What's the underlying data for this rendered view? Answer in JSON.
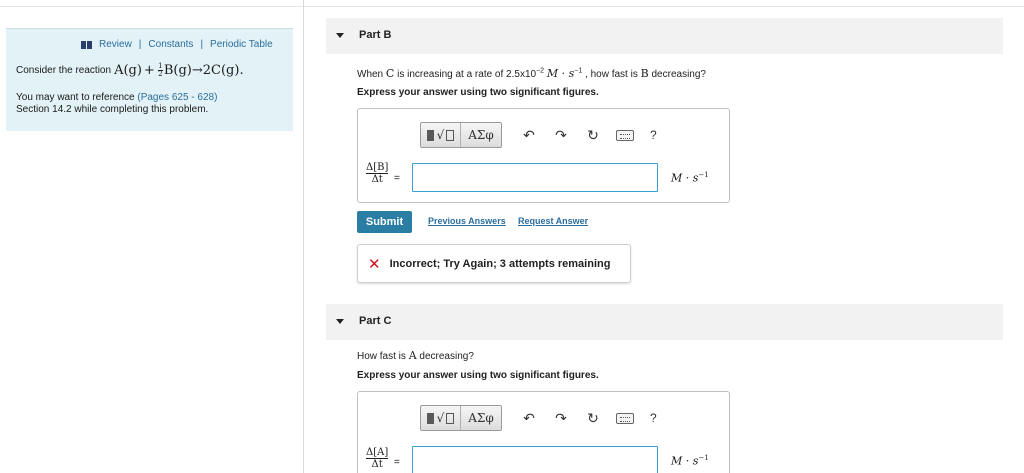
{
  "left_panel": {
    "links": {
      "review": "Review",
      "constants": "Constants",
      "periodic_table": "Periodic Table"
    },
    "reaction_prefix": "Consider the reaction",
    "reaction": {
      "a": "A(g)",
      "plus": "+",
      "half_num": "1",
      "half_den": "2",
      "b": "B(g)",
      "arrow": "→",
      "c": "2C(g)",
      "period": "."
    },
    "reference_prefix": "You may want to reference",
    "reference_pages": "(Pages 625 - 628)",
    "reference_suffix": "Section 14.2 while completing this problem."
  },
  "part_b": {
    "title": "Part B",
    "question": {
      "pre": "When",
      "species": "C",
      "mid": "is increasing at a rate of 2.5x10",
      "exp": "−2",
      "unit": "M · s",
      "unit_exp": "−1",
      "post": ", how fast is",
      "target": "B",
      "end": "decreasing?"
    },
    "instruction": "Express your answer using two significant figures.",
    "answer_label": {
      "num": "Δ[B]",
      "den": "Δt",
      "eq": "="
    },
    "input_value": "",
    "unit": {
      "base": "M · s",
      "exp": "−1"
    },
    "submit_label": "Submit",
    "previous_answers": "Previous Answers",
    "request_answer": "Request Answer",
    "feedback": "Incorrect; Try Again; 3 attempts remaining"
  },
  "part_c": {
    "title": "Part C",
    "question": {
      "pre": "How fast is",
      "species": "A",
      "post": "decreasing?"
    },
    "instruction": "Express your answer using two significant figures.",
    "answer_label": {
      "num": "Δ[A]",
      "den": "Δt",
      "eq": "="
    },
    "input_value": "",
    "unit": {
      "base": "M · s",
      "exp": "−1"
    }
  },
  "toolbar": {
    "greek": "ΑΣφ",
    "undo_icon": "undo-arrow",
    "redo_icon": "redo-arrow",
    "reset_icon": "reset-circular-arrow",
    "keyboard_icon": "keyboard",
    "help": "?"
  },
  "colors": {
    "panel_bg": "#e3f2f6",
    "link": "#2a6e9e",
    "submit": "#2a7ea4",
    "input_border": "#39a0d6",
    "error": "#d0141f"
  }
}
